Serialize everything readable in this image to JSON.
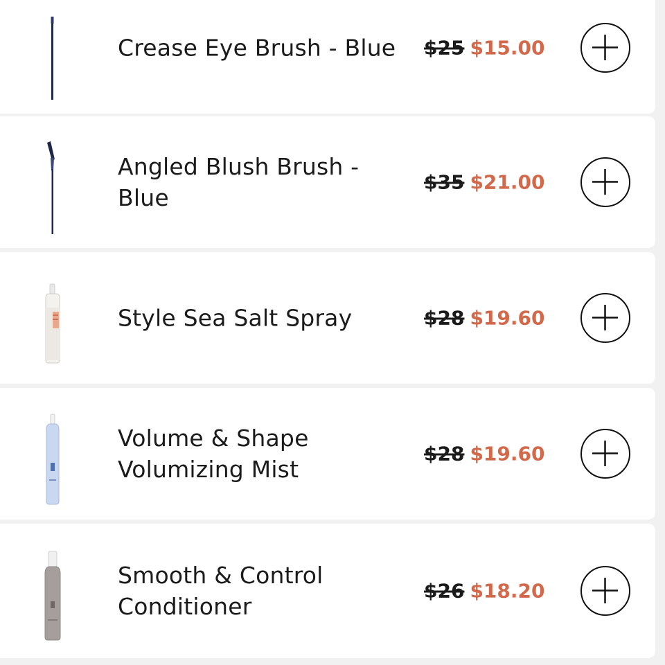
{
  "products": [
    {
      "name": "Crease Eye Brush - Blue",
      "old_price": "$25",
      "new_price": "$15.00",
      "thumb": "eye-brush-blue-icon"
    },
    {
      "name": "Angled Blush Brush - Blue",
      "old_price": "$35",
      "new_price": "$21.00",
      "thumb": "blush-brush-blue-icon"
    },
    {
      "name": "Style Sea Salt Spray",
      "old_price": "$28",
      "new_price": "$19.60",
      "thumb": "sea-salt-spray-bottle-icon"
    },
    {
      "name": "Volume & Shape Volumizing Mist",
      "old_price": "$28",
      "new_price": "$19.60",
      "thumb": "volumizing-mist-bottle-icon"
    },
    {
      "name": "Smooth & Control Conditioner",
      "old_price": "$26",
      "new_price": "$18.20",
      "thumb": "conditioner-bottle-icon"
    }
  ],
  "colors": {
    "sale_price": "#d2694b",
    "text": "#1b1b1b",
    "background": "#f1f1f2",
    "card": "#ffffff"
  }
}
